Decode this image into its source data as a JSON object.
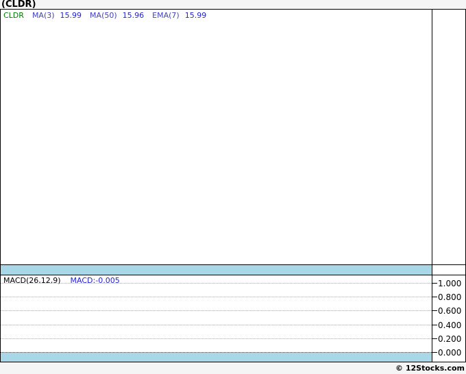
{
  "header": {
    "title": "(CLDR)"
  },
  "main_chart": {
    "legend": {
      "symbol": "CLDR",
      "items": [
        {
          "label": "MA(3)",
          "value": "15.99"
        },
        {
          "label": "MA(50)",
          "value": "15.96"
        },
        {
          "label": "EMA(7)",
          "value": "15.99"
        }
      ]
    }
  },
  "macd_panel": {
    "legend_label": "MACD(26,12,9)",
    "legend_value": "MACD:-0.005",
    "axis_ticks": [
      "1.000",
      "0.800",
      "0.600",
      "0.400",
      "0.200",
      "0.000"
    ]
  },
  "footer": {
    "credit": "© 12Stocks.com"
  },
  "colors": {
    "band_blue": "#a8d8e8",
    "symbol_green": "#007a00",
    "indicator_label_blue": "#4040c0",
    "value_blue": "#2323d4",
    "grid_gray": "#a6a6a6",
    "background_gray": "#f5f5f5"
  },
  "chart_data": [
    {
      "type": "line",
      "panel": "price",
      "title": "(CLDR)",
      "series": [
        {
          "name": "CLDR",
          "values": []
        },
        {
          "name": "MA(3)",
          "last_value": 15.99,
          "values": []
        },
        {
          "name": "MA(50)",
          "last_value": 15.96,
          "values": []
        },
        {
          "name": "EMA(7)",
          "last_value": 15.99,
          "values": []
        }
      ],
      "legend_position": "top-left",
      "note": "plot area rendered empty - no price curve visible"
    },
    {
      "type": "line",
      "panel": "indicator",
      "title": "MACD(26,12,9)",
      "series": [
        {
          "name": "MACD",
          "last_value": -0.005,
          "values": []
        }
      ],
      "ylim": [
        0.0,
        1.0
      ],
      "yticks": [
        1.0,
        0.8,
        0.6,
        0.4,
        0.2,
        0.0
      ],
      "grid": "horizontal dotted",
      "legend_position": "top-left",
      "note": "no MACD curve rendered; only dotted gridlines and right axis labels"
    }
  ]
}
